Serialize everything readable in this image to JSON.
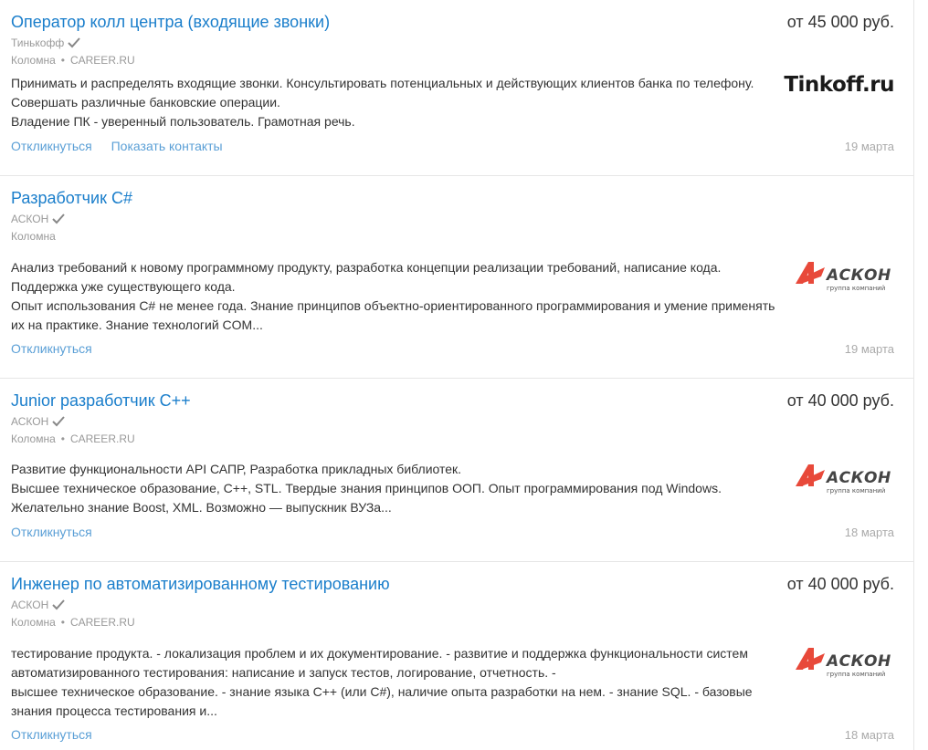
{
  "vacancies": [
    {
      "title": "Оператор колл центра (входящие звонки)",
      "salary": "от 45 000 руб.",
      "company": "Тинькофф",
      "city": "Коломна",
      "source": "CAREER.RU",
      "description": [
        "Принимать и распределять входящие звонки. Консультировать потенциальных и действующих клиентов банка по телефону.",
        "Совершать различные банковские операции.",
        "Владение ПК - уверенный пользователь. Грамотная речь."
      ],
      "actions": {
        "respond": "Откликнуться",
        "show_contacts": "Показать контакты"
      },
      "date": "19 марта",
      "logo": "Tinkoff.ru"
    },
    {
      "title": "Разработчик C#",
      "salary": "",
      "company": "АСКОН",
      "city": "Коломна",
      "source": "",
      "description": [
        "Анализ требований к новому программному продукту, разработка концепции реализации требований, написание кода.",
        "Поддержка уже существующего кода.",
        "Опыт использования C# не менее года. Знание принципов объектно-ориентированного программирования и умение применять",
        "их на практике. Знание технологий COM..."
      ],
      "actions": {
        "respond": "Откликнуться"
      },
      "date": "19 марта",
      "logo": {
        "name": "АСКОН",
        "tagline": "группа компаний"
      }
    },
    {
      "title": "Junior разработчик C++",
      "salary": "от 40 000 руб.",
      "company": "АСКОН",
      "city": "Коломна",
      "source": "CAREER.RU",
      "description": [
        "Развитие функциональности API САПР, Разработка прикладных библиотек.",
        "Высшее техническое образование, C++, STL. Твердые знания принципов ООП. Опыт программирования под Windows.",
        "Желательно знание Boost, XML. Возможно — выпускник ВУЗа..."
      ],
      "actions": {
        "respond": "Откликнуться"
      },
      "date": "18 марта",
      "logo": {
        "name": "АСКОН",
        "tagline": "группа компаний"
      }
    },
    {
      "title": "Инженер по автоматизированному тестированию",
      "salary": "от 40 000 руб.",
      "company": "АСКОН",
      "city": "Коломна",
      "source": "CAREER.RU",
      "description": [
        "тестирование продукта. - локализация проблем и их документирование. - развитие и поддержка функциональности систем",
        "автоматизированного тестирования: написание и запуск тестов, логирование, отчетность. -",
        "высшее техническое образование. - знание языка C++ (или C#), наличие опыта разработки на нем. - знание SQL. - базовые",
        "знания процесса тестирования и..."
      ],
      "actions": {
        "respond": "Откликнуться"
      },
      "date": "18 марта",
      "logo": {
        "name": "АСКОН",
        "tagline": "группа компаний"
      }
    }
  ],
  "colors": {
    "link": "#1a7ecb",
    "action": "#5a9fd6",
    "muted": "#999999",
    "askon_red": "#e8493a"
  }
}
